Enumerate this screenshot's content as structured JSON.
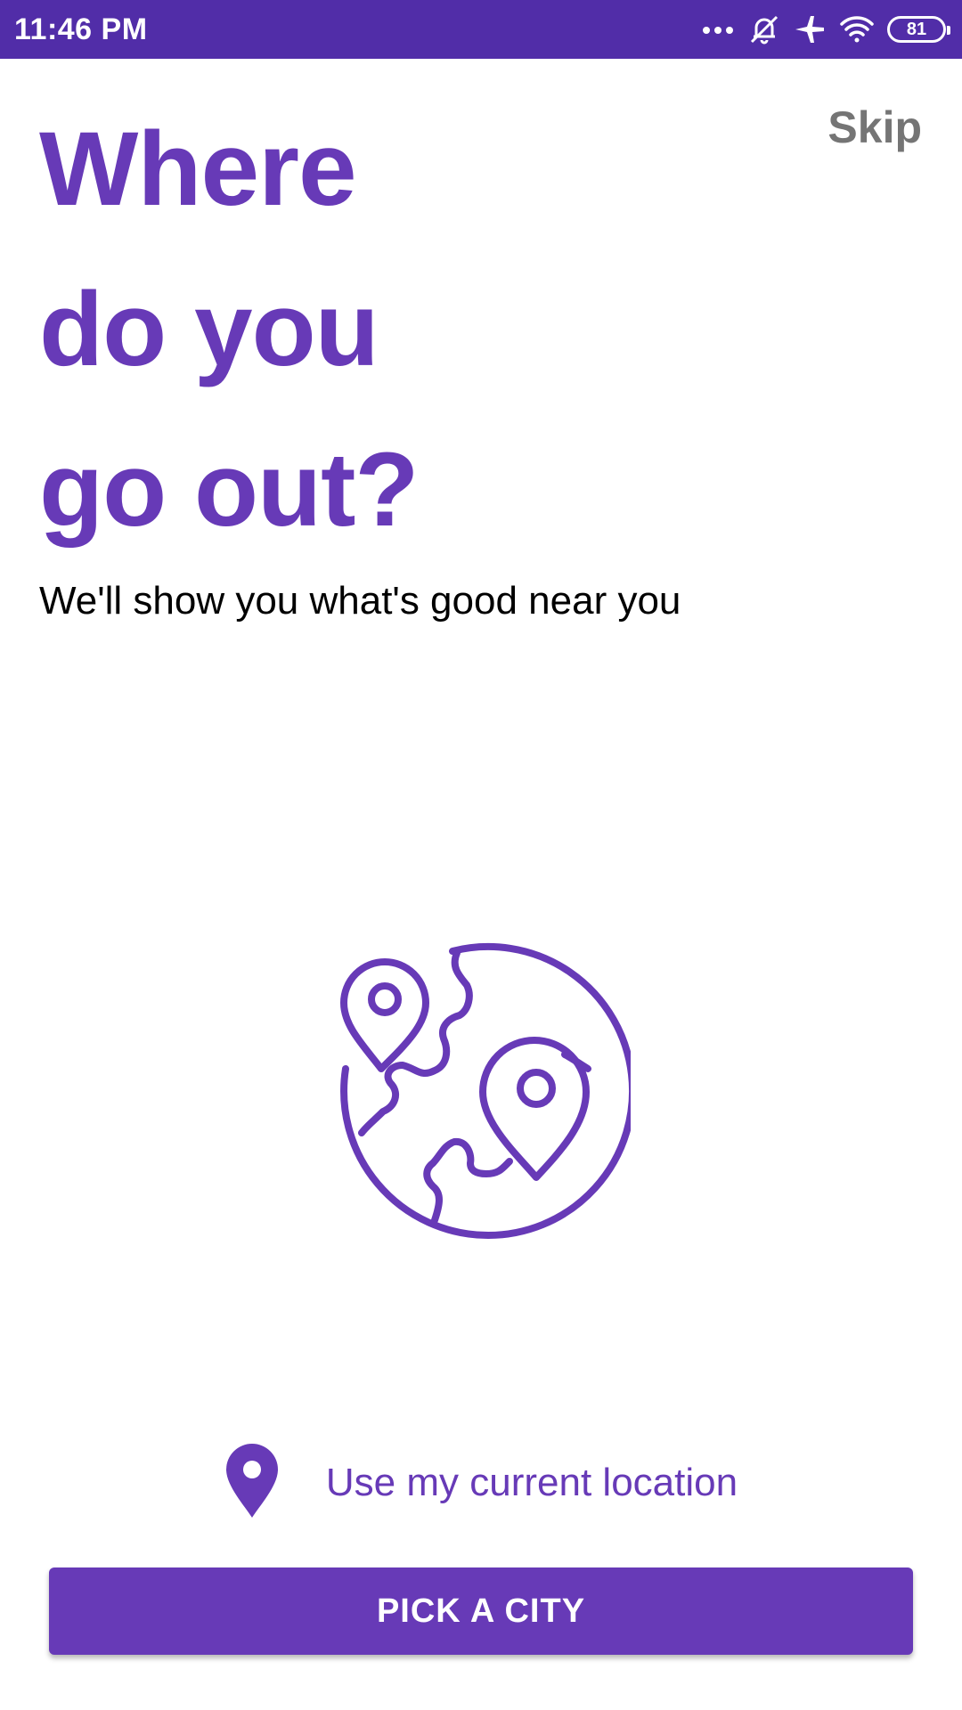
{
  "status_bar": {
    "time": "11:46 PM",
    "icons": [
      "more-dots-icon",
      "bell-off-icon",
      "airplane-icon",
      "wifi-icon",
      "battery-icon"
    ],
    "battery_level": "81",
    "background_color": "#512DA8"
  },
  "header": {
    "skip_label": "Skip"
  },
  "headline": {
    "lines": [
      "Where",
      "do you",
      "go out?"
    ]
  },
  "subtitle": "We'll show you what's good near you",
  "illustration": {
    "icon": "globe-with-location-pins-icon"
  },
  "use_location": {
    "icon": "location-pin-icon",
    "label": "Use my current location"
  },
  "primary_button": {
    "label": "PICK A CITY"
  },
  "colors": {
    "accent": "#673AB7",
    "status_bar": "#512DA8",
    "skip_text": "#757575"
  }
}
